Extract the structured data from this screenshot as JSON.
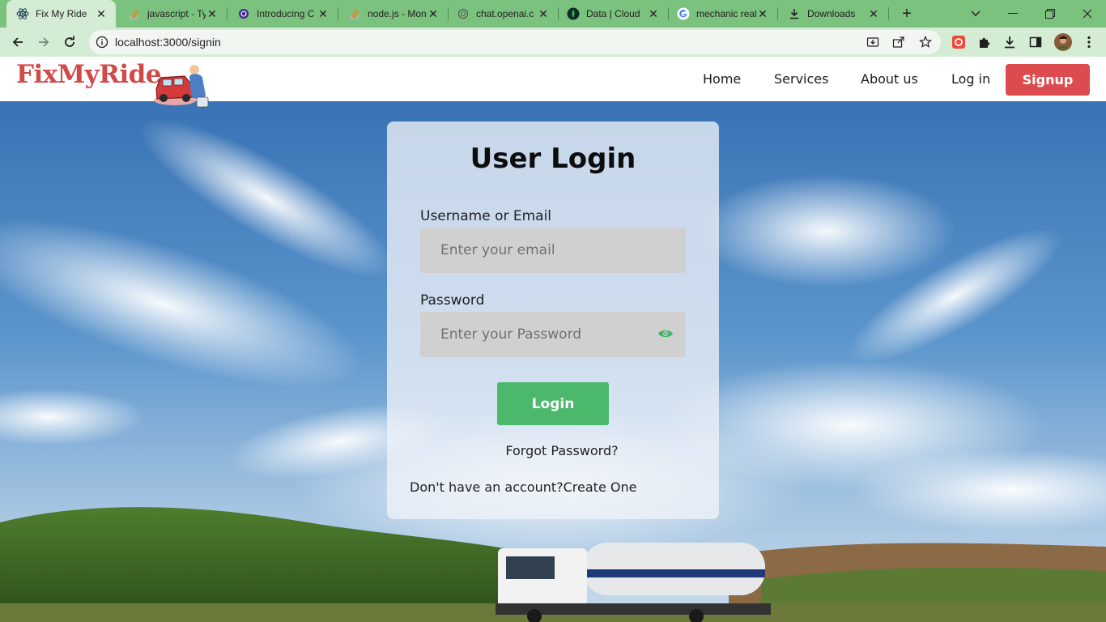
{
  "browser": {
    "tabs": [
      {
        "title": "Fix My Ride",
        "active": true,
        "icon": "react-icon"
      },
      {
        "title": "javascript - Ty",
        "active": false,
        "icon": "stackoverflow-icon"
      },
      {
        "title": "Introducing C",
        "active": false,
        "icon": "openai-icon"
      },
      {
        "title": "node.js - Mon",
        "active": false,
        "icon": "stackoverflow-icon"
      },
      {
        "title": "chat.openai.c",
        "active": false,
        "icon": "openai-icon"
      },
      {
        "title": "Data | Cloud",
        "active": false,
        "icon": "mongodb-leaf-icon"
      },
      {
        "title": "mechanic real",
        "active": false,
        "icon": "google-icon"
      },
      {
        "title": "Downloads",
        "active": false,
        "icon": "download-icon"
      }
    ],
    "url": "localhost:3000/signin",
    "theme_color": "#7cc27f"
  },
  "site": {
    "logo": "FixMyRide",
    "nav": {
      "home": "Home",
      "services": "Services",
      "about": "About us",
      "login": "Log in",
      "signup": "Signup"
    },
    "accent": "#dc4c4f"
  },
  "login": {
    "title": "User Login",
    "username_label": "Username or Email",
    "username_placeholder": "Enter your email",
    "password_label": "Password",
    "password_placeholder": "Enter your Password",
    "submit": "Login",
    "forgot": "Forgot Password?",
    "no_account": "Don't have an account?Create One",
    "button_color": "#4cb86b"
  }
}
